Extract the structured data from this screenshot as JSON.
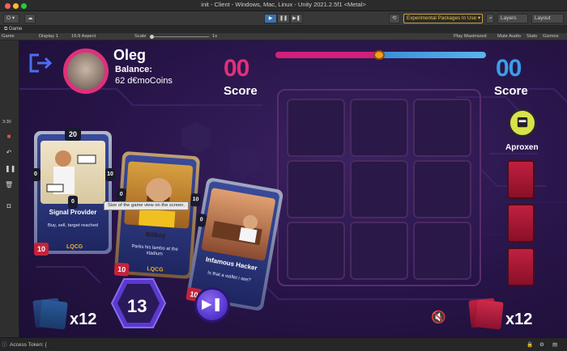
{
  "window": {
    "title": "init - Client - Windows, Mac, Linux - Unity 2021.2.5f1 <Metal>"
  },
  "toolbar": {
    "account_label": "O ▾",
    "cloud_icon": "cloud-icon",
    "play_icons": [
      "play-icon",
      "pause-icon",
      "step-icon"
    ],
    "experimental_packages": "Experimental Packages In Use ▾",
    "layers_label": "Layers",
    "layout_label": "Layout"
  },
  "tab": {
    "label": "Game"
  },
  "gamebar": {
    "mode": "Game",
    "display": "Display 1",
    "aspect": "16:9 Aspect",
    "scale_label": "Scale",
    "scale_value": "1x",
    "play_maximized": "Play Maximized",
    "mute_audio": "Mute Audio",
    "stats": "Stats",
    "gizmos": "Gizmos"
  },
  "leftstrip": {
    "time": "3:30"
  },
  "player": {
    "name": "Oleg",
    "balance_label": "Balance:",
    "balance_value": "62 d€moCoins",
    "score": "00",
    "score_label": "Score"
  },
  "opponent": {
    "name": "Aproxen",
    "score": "00",
    "score_label": "Score"
  },
  "cards": [
    {
      "title": "Signal Provider",
      "desc": "Buy, sell, target reached",
      "top_stat": "20",
      "left_stat": "0",
      "right_stat": "10",
      "bottom_stat": "0",
      "cost": "10",
      "brand": "LQCG"
    },
    {
      "title": "Bitboy",
      "desc": "Parks his lambo at the stadium",
      "left_stat": "0",
      "right_stat": "10",
      "cost": "10",
      "brand": "LQCG"
    },
    {
      "title": "Infamous Hacker",
      "desc": "Is that a wallet i see?",
      "left_stat": "0",
      "cost": "10"
    }
  ],
  "tooltip": {
    "text": "Size of the game view on the screen."
  },
  "bottom": {
    "player_deck_count": "x12",
    "turn_number": "13",
    "end_turn_icon": "skip-next-icon",
    "mute_icon": "speaker-muted-icon",
    "opponent_deck_count": "x12"
  },
  "statusbar": {
    "text": "Access Token: {"
  },
  "colors": {
    "player_accent": "#e0307a",
    "opponent_accent": "#3a9ee8",
    "background": "#271447"
  }
}
